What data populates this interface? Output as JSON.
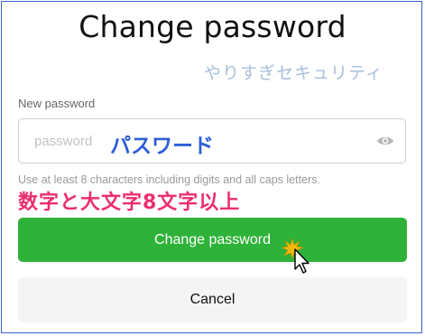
{
  "dialog": {
    "title": "Change password",
    "annotation_top": "やりすぎセキュリティ",
    "field_label": "New password",
    "input_placeholder": "password",
    "input_annotation": "パスワード",
    "hint": "Use at least 8 characters including digits and all caps letters.",
    "annotation_hint": "数字と大文字8文字以上",
    "primary_button": "Change password",
    "secondary_button": "Cancel"
  },
  "icons": {
    "visibility_toggle": "eye-icon",
    "pointer": "cursor-icon"
  },
  "colors": {
    "primary": "#2fb23a",
    "annotation_blue": "#2e5fd6",
    "annotation_pink": "#ec2e70",
    "annotation_light_blue": "#a9bfdb",
    "frame_border": "#3d5fd0"
  }
}
